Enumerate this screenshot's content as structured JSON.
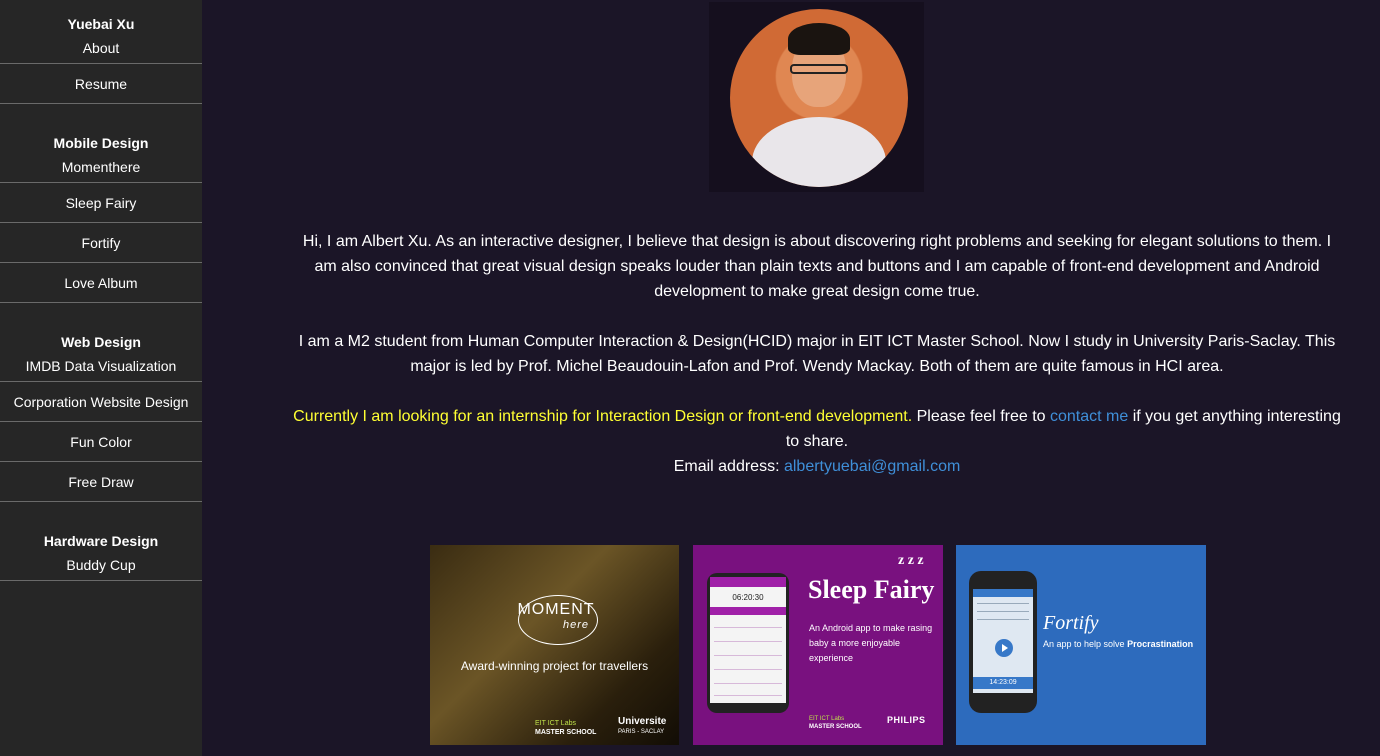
{
  "sidebar": {
    "name": "Yuebai Xu",
    "top_items": [
      "About",
      "Resume"
    ],
    "sections": [
      {
        "heading": "Mobile Design",
        "items": [
          "Momenthere",
          "Sleep Fairy",
          "Fortify",
          "Love Album"
        ]
      },
      {
        "heading": "Web Design",
        "items": [
          "IMDB Data Visualization",
          "Corporation Website Design",
          "Fun Color",
          "Free Draw"
        ]
      },
      {
        "heading": "Hardware Design",
        "items": [
          "Buddy Cup"
        ]
      }
    ]
  },
  "intro": {
    "p1": "Hi, I am Albert Xu. As an interactive designer, I believe that design is about discovering right problems and seeking for elegant solutions to them. I am also convinced that great visual design speaks louder than plain texts and buttons and I am capable of front-end development and Android development to make great design come true.",
    "p2": "I am a M2 student from Human Computer Interaction & Design(HCID) major in EIT ICT Master School. Now I study in University Paris-Saclay. This major is led by Prof. Michel Beaudouin-Lafon and Prof. Wendy Mackay. Both of them are quite famous in HCI area.",
    "internship_highlight": "Currently I am looking for an internship for Interaction Design or front-end development.",
    "feel_free": " Please feel free to ",
    "contact_link": "contact me",
    "after_contact": " if you get anything interesting to share.",
    "email_label": "Email address: ",
    "email": "albertyuebai@gmail.com"
  },
  "projects": {
    "moment": {
      "logo": "MOMENT",
      "logo_sub": "here",
      "tagline": "Award-winning project for travellers",
      "eit_line1": "EIT ICT Labs",
      "eit_line2": "MASTER SCHOOL",
      "uni_line1": "Universite",
      "uni_line2": "PARIS - SACLAY"
    },
    "sleep": {
      "title": "Sleep Fairy",
      "z": "z z z",
      "desc": "An Android app to make rasing baby a more enjoyable experience",
      "phone_time": "06:20:30",
      "eit_line1": "EIT ICT Labs",
      "eit_line2": "MASTER SCHOOL",
      "partner": "PHILIPS"
    },
    "fortify": {
      "title": "Fortify",
      "desc_prefix": "An app to help solve ",
      "desc_bold": "Procrastination",
      "phone_timer": "14:23:09"
    }
  },
  "colors": {
    "background": "#1b1527",
    "sidebar": "#262626",
    "highlight": "#ffff33",
    "link": "#3f8fd8"
  }
}
